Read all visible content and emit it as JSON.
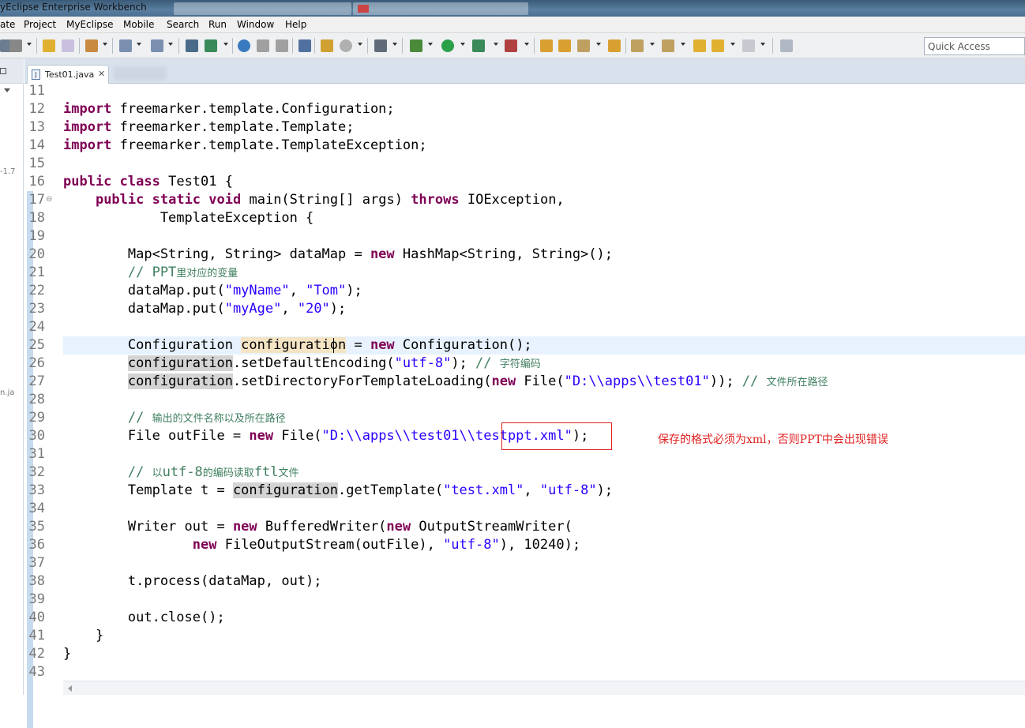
{
  "window": {
    "title": "yEclipse Enterprise Workbench"
  },
  "menu": [
    "ate",
    "Project",
    "MyEclipse",
    "Mobile",
    "Search",
    "Run",
    "Window",
    "Help"
  ],
  "toolbar": {
    "quick_access_placeholder": "Quick Access"
  },
  "left_panel": {
    "fragment1": "-1.7",
    "fragment2": "n.ja"
  },
  "editor": {
    "tab_label": "Test01.java",
    "tab_close": "✕",
    "lines": [
      {
        "n": "11",
        "segs": []
      },
      {
        "n": "12",
        "segs": [
          [
            "kw",
            "import"
          ],
          [
            "p",
            " freemarker.template.Configuration;"
          ]
        ]
      },
      {
        "n": "13",
        "segs": [
          [
            "kw",
            "import"
          ],
          [
            "p",
            " freemarker.template.Template;"
          ]
        ]
      },
      {
        "n": "14",
        "segs": [
          [
            "kw",
            "import"
          ],
          [
            "p",
            " freemarker.template.TemplateException;"
          ]
        ]
      },
      {
        "n": "15",
        "segs": []
      },
      {
        "n": "16",
        "segs": [
          [
            "kw",
            "public"
          ],
          [
            "p",
            " "
          ],
          [
            "kw",
            "class"
          ],
          [
            "p",
            " Test01 {"
          ]
        ]
      },
      {
        "n": "17",
        "segs": [
          [
            "p",
            "    "
          ],
          [
            "kw",
            "public"
          ],
          [
            "p",
            " "
          ],
          [
            "kw",
            "static"
          ],
          [
            "p",
            " "
          ],
          [
            "kw",
            "void"
          ],
          [
            "p",
            " main(String[] args) "
          ],
          [
            "kw",
            "throws"
          ],
          [
            "p",
            " IOException,"
          ]
        ]
      },
      {
        "n": "18",
        "segs": [
          [
            "p",
            "            TemplateException {"
          ]
        ]
      },
      {
        "n": "19",
        "segs": []
      },
      {
        "n": "20",
        "segs": [
          [
            "p",
            "        Map<String, String> dataMap = "
          ],
          [
            "kw",
            "new"
          ],
          [
            "p",
            " HashMap<String, String>();"
          ]
        ]
      },
      {
        "n": "21",
        "segs": [
          [
            "cm",
            "        // PPT"
          ],
          [
            "cmcn",
            "里对应的变量"
          ]
        ]
      },
      {
        "n": "22",
        "segs": [
          [
            "p",
            "        dataMap.put("
          ],
          [
            "str",
            "\"myName\""
          ],
          [
            "p",
            ", "
          ],
          [
            "str",
            "\"Tom\""
          ],
          [
            "p",
            ");"
          ]
        ]
      },
      {
        "n": "23",
        "segs": [
          [
            "p",
            "        dataMap.put("
          ],
          [
            "str",
            "\"myAge\""
          ],
          [
            "p",
            ", "
          ],
          [
            "str",
            "\"20\""
          ],
          [
            "p",
            ");"
          ]
        ]
      },
      {
        "n": "24",
        "segs": []
      },
      {
        "n": "25",
        "segs": [
          [
            "p",
            "        Configuration "
          ],
          [
            "occw",
            "configuration"
          ],
          [
            "p",
            " = "
          ],
          [
            "kw",
            "new"
          ],
          [
            "p",
            " Configuration();"
          ]
        ]
      },
      {
        "n": "26",
        "segs": [
          [
            "p",
            "        "
          ],
          [
            "occ",
            "configuration"
          ],
          [
            "p",
            ".setDefaultEncoding("
          ],
          [
            "str",
            "\"utf-8\""
          ],
          [
            "p",
            "); "
          ],
          [
            "cm",
            "// "
          ],
          [
            "cmcn",
            "字符编码"
          ]
        ]
      },
      {
        "n": "27",
        "segs": [
          [
            "p",
            "        "
          ],
          [
            "occ",
            "configuration"
          ],
          [
            "p",
            ".setDirectoryForTemplateLoading("
          ],
          [
            "kw",
            "new"
          ],
          [
            "p",
            " File("
          ],
          [
            "str",
            "\"D:\\\\apps\\\\test01\""
          ],
          [
            "p",
            "));"
          ],
          [
            "cm",
            " // "
          ],
          [
            "cmcn",
            "文件所在路径"
          ]
        ]
      },
      {
        "n": "28",
        "segs": []
      },
      {
        "n": "29",
        "segs": [
          [
            "cm",
            "        // "
          ],
          [
            "cmcn",
            "输出的文件名称以及所在路径"
          ]
        ]
      },
      {
        "n": "30",
        "segs": [
          [
            "p",
            "        File outFile = "
          ],
          [
            "kw",
            "new"
          ],
          [
            "p",
            " File("
          ],
          [
            "str",
            "\"D:\\\\apps\\\\test01\\\\testppt.xml\""
          ],
          [
            "p",
            ");"
          ]
        ]
      },
      {
        "n": "31",
        "segs": []
      },
      {
        "n": "32",
        "segs": [
          [
            "cm",
            "        // "
          ],
          [
            "cmcn",
            "以"
          ],
          [
            "cm",
            "utf-8"
          ],
          [
            "cmcn",
            "的编码读取"
          ],
          [
            "cm",
            "ftl"
          ],
          [
            "cmcn",
            "文件"
          ]
        ]
      },
      {
        "n": "33",
        "segs": [
          [
            "p",
            "        Template t = "
          ],
          [
            "occ",
            "configuration"
          ],
          [
            "p",
            ".getTemplate("
          ],
          [
            "str",
            "\"test.xml\""
          ],
          [
            "p",
            ", "
          ],
          [
            "str",
            "\"utf-8\""
          ],
          [
            "p",
            ");"
          ]
        ]
      },
      {
        "n": "34",
        "segs": []
      },
      {
        "n": "35",
        "segs": [
          [
            "p",
            "        Writer out = "
          ],
          [
            "kw",
            "new"
          ],
          [
            "p",
            " BufferedWriter("
          ],
          [
            "kw",
            "new"
          ],
          [
            "p",
            " OutputStreamWriter("
          ]
        ]
      },
      {
        "n": "36",
        "segs": [
          [
            "p",
            "                "
          ],
          [
            "kw",
            "new"
          ],
          [
            "p",
            " FileOutputStream(outFile), "
          ],
          [
            "str",
            "\"utf-8\""
          ],
          [
            "p",
            "), 10240);"
          ]
        ]
      },
      {
        "n": "37",
        "segs": []
      },
      {
        "n": "38",
        "segs": [
          [
            "p",
            "        t.process(dataMap, out);"
          ]
        ]
      },
      {
        "n": "39",
        "segs": []
      },
      {
        "n": "40",
        "segs": [
          [
            "p",
            "        out.close();"
          ]
        ]
      },
      {
        "n": "41",
        "segs": [
          [
            "p",
            "    }"
          ]
        ]
      },
      {
        "n": "42",
        "segs": [
          [
            "p",
            "}"
          ]
        ]
      },
      {
        "n": "43",
        "segs": []
      }
    ]
  },
  "annotation": {
    "text": "保存的格式必须为xml，否则PPT中会出现错误",
    "color": "#e02020"
  },
  "colors": {
    "keyword": "#7f0055",
    "string": "#2a00ff",
    "comment": "#3f7f5f",
    "current_line": "#e8f2fe"
  }
}
